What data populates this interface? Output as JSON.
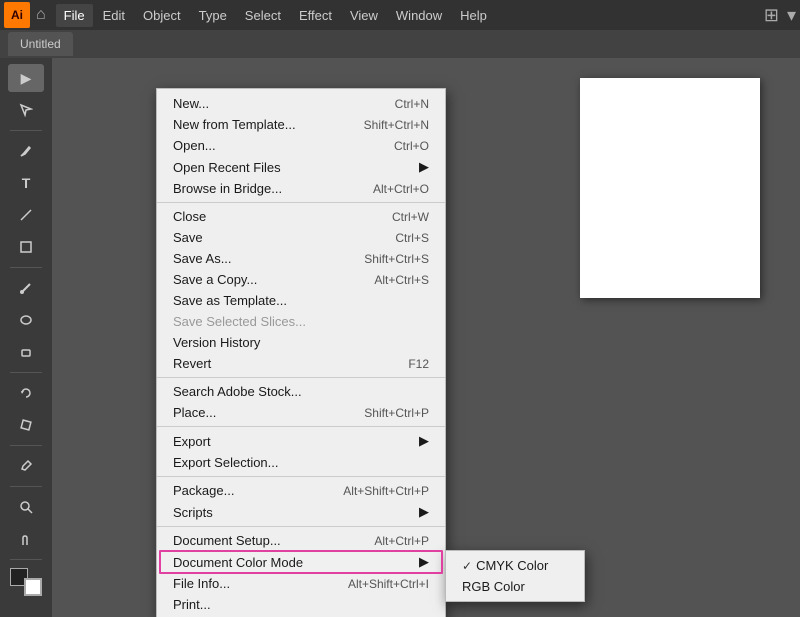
{
  "app": {
    "logo": "Ai",
    "tab_label": "Untitled"
  },
  "menubar": {
    "items": [
      "File",
      "Edit",
      "Object",
      "Type",
      "Select",
      "Effect",
      "View",
      "Window",
      "Help"
    ]
  },
  "file_menu": {
    "items": [
      {
        "label": "New...",
        "shortcut": "Ctrl+N",
        "disabled": false,
        "has_arrow": false
      },
      {
        "label": "New from Template...",
        "shortcut": "Shift+Ctrl+N",
        "disabled": false,
        "has_arrow": false
      },
      {
        "label": "Open...",
        "shortcut": "Ctrl+O",
        "disabled": false,
        "has_arrow": false
      },
      {
        "label": "Open Recent Files",
        "shortcut": "",
        "disabled": false,
        "has_arrow": true
      },
      {
        "label": "Browse in Bridge...",
        "shortcut": "Alt+Ctrl+O",
        "disabled": false,
        "has_arrow": false
      },
      {
        "separator": true
      },
      {
        "label": "Close",
        "shortcut": "Ctrl+W",
        "disabled": false,
        "has_arrow": false
      },
      {
        "label": "Save",
        "shortcut": "Ctrl+S",
        "disabled": false,
        "has_arrow": false
      },
      {
        "label": "Save As...",
        "shortcut": "Shift+Ctrl+S",
        "disabled": false,
        "has_arrow": false
      },
      {
        "label": "Save a Copy...",
        "shortcut": "Alt+Ctrl+S",
        "disabled": false,
        "has_arrow": false
      },
      {
        "label": "Save as Template...",
        "shortcut": "",
        "disabled": false,
        "has_arrow": false
      },
      {
        "label": "Save Selected Slices...",
        "shortcut": "",
        "disabled": true,
        "has_arrow": false
      },
      {
        "label": "Version History",
        "shortcut": "",
        "disabled": false,
        "has_arrow": false
      },
      {
        "label": "Revert",
        "shortcut": "F12",
        "disabled": false,
        "has_arrow": false
      },
      {
        "separator": true
      },
      {
        "label": "Search Adobe Stock...",
        "shortcut": "",
        "disabled": false,
        "has_arrow": false
      },
      {
        "label": "Place...",
        "shortcut": "Shift+Ctrl+P",
        "disabled": false,
        "has_arrow": false
      },
      {
        "separator": true
      },
      {
        "label": "Export",
        "shortcut": "",
        "disabled": false,
        "has_arrow": true
      },
      {
        "label": "Export Selection...",
        "shortcut": "",
        "disabled": false,
        "has_arrow": false
      },
      {
        "separator": true
      },
      {
        "label": "Package...",
        "shortcut": "Alt+Shift+Ctrl+P",
        "disabled": false,
        "has_arrow": false
      },
      {
        "label": "Scripts",
        "shortcut": "",
        "disabled": false,
        "has_arrow": true
      },
      {
        "separator": true
      },
      {
        "label": "Document Setup...",
        "shortcut": "Alt+Ctrl+P",
        "disabled": false,
        "has_arrow": false
      },
      {
        "label": "Document Color Mode",
        "shortcut": "",
        "disabled": false,
        "has_arrow": true,
        "highlighted": true
      },
      {
        "label": "File Info...",
        "shortcut": "Alt+Shift+Ctrl+I",
        "disabled": false,
        "has_arrow": false
      },
      {
        "label": "Print...",
        "shortcut": "",
        "disabled": false,
        "has_arrow": false
      }
    ]
  },
  "color_mode_submenu": {
    "items": [
      {
        "label": "CMYK Color",
        "checked": true
      },
      {
        "label": "RGB Color",
        "checked": false
      }
    ]
  },
  "toolbar": {
    "tools": [
      "▶",
      "✦",
      "✏",
      "⬡",
      "T",
      "🔗",
      "🎨",
      "⬜",
      "✂",
      "⊕",
      "🔍",
      "✋"
    ]
  }
}
